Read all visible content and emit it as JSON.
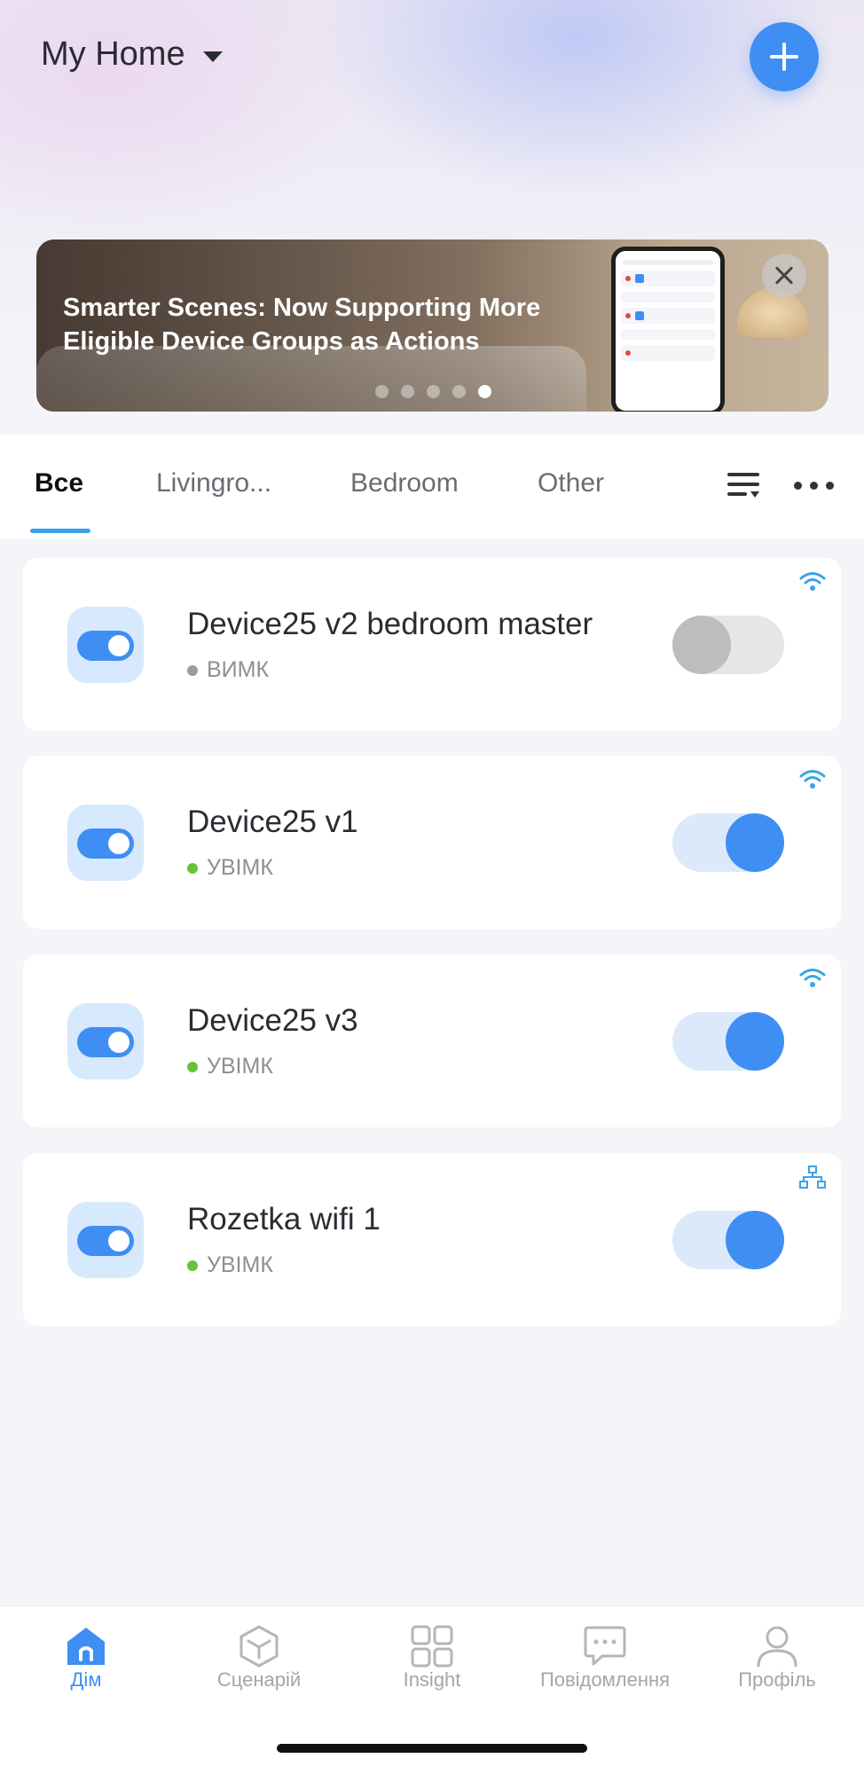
{
  "header": {
    "home_title": "My Home"
  },
  "banner": {
    "text": "Smarter Scenes: Now Supporting More Eligible Device Groups as Actions",
    "dots_total": 5,
    "active_dot": 5
  },
  "tabs": [
    {
      "label": "Все",
      "active": true
    },
    {
      "label": "Livingro...",
      "active": false
    },
    {
      "label": "Bedroom",
      "active": false
    },
    {
      "label": "Other",
      "active": false
    }
  ],
  "devices": [
    {
      "name": "Device25 v2 bedroom master",
      "status": "ВИМК",
      "on": false,
      "connection": "wifi-icon",
      "status_color": "#9a9aa0"
    },
    {
      "name": "Device25 v1",
      "status": "УВІМК",
      "on": true,
      "connection": "wifi-icon",
      "status_color": "#67c23a"
    },
    {
      "name": "Device25 v3",
      "status": "УВІМК",
      "on": true,
      "connection": "wifi-icon",
      "status_color": "#67c23a"
    },
    {
      "name": "Rozetka wifi 1",
      "status": "УВІМК",
      "on": true,
      "connection": "network-hub-icon",
      "status_color": "#67c23a"
    }
  ],
  "bottom_nav": [
    {
      "label": "Дім",
      "icon": "home-icon",
      "active": true
    },
    {
      "label": "Сценарій",
      "icon": "scene-cube-icon",
      "active": false
    },
    {
      "label": "Insight",
      "icon": "grid-icon",
      "active": false
    },
    {
      "label": "Повідомлення",
      "icon": "message-icon",
      "active": false
    },
    {
      "label": "Профіль",
      "icon": "profile-icon",
      "active": false
    }
  ],
  "colors": {
    "accent": "#3f8ef3",
    "tab_underline": "#3aa3e8",
    "on_dot": "#67c23a",
    "off_dot": "#9a9aa0"
  }
}
